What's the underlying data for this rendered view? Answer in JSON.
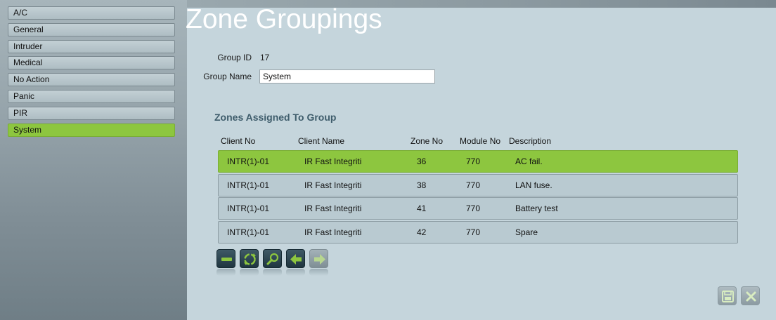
{
  "sidebar": {
    "items": [
      {
        "label": "A/C"
      },
      {
        "label": "General"
      },
      {
        "label": "Intruder"
      },
      {
        "label": "Medical"
      },
      {
        "label": "No Action"
      },
      {
        "label": "Panic"
      },
      {
        "label": "PIR"
      },
      {
        "label": "System",
        "selected": true
      }
    ]
  },
  "page": {
    "title": "Zone Groupings"
  },
  "form": {
    "group_id_label": "Group ID",
    "group_id_value": "17",
    "group_name_label": "Group Name",
    "group_name_value": "System"
  },
  "zones": {
    "title": "Zones Assigned To Group",
    "columns": [
      "Client No",
      "Client Name",
      "Zone No",
      "Module No",
      "Description"
    ],
    "rows": [
      {
        "client_no": "INTR(1)-01",
        "client_name": "IR Fast Integriti",
        "zone_no": "36",
        "module_no": "770",
        "description": "AC fail.",
        "selected": true
      },
      {
        "client_no": "INTR(1)-01",
        "client_name": "IR Fast Integriti",
        "zone_no": "38",
        "module_no": "770",
        "description": "LAN fuse."
      },
      {
        "client_no": "INTR(1)-01",
        "client_name": "IR Fast Integriti",
        "zone_no": "41",
        "module_no": "770",
        "description": "Battery test"
      },
      {
        "client_no": "INTR(1)-01",
        "client_name": "IR Fast Integriti",
        "zone_no": "42",
        "module_no": "770",
        "description": "Spare"
      }
    ]
  },
  "toolbar": {
    "icons": [
      "minus-icon",
      "refresh-icon",
      "search-icon",
      "arrow-left-icon",
      "arrow-right-icon"
    ]
  },
  "footer": {
    "icons": [
      "save-icon",
      "close-icon"
    ]
  },
  "colors": {
    "accent": "#8dc63f",
    "background": "#c5d5dc",
    "sidebar": "#8a989f",
    "section_title": "#3e5c6b",
    "button_dark": "#2a4450"
  }
}
